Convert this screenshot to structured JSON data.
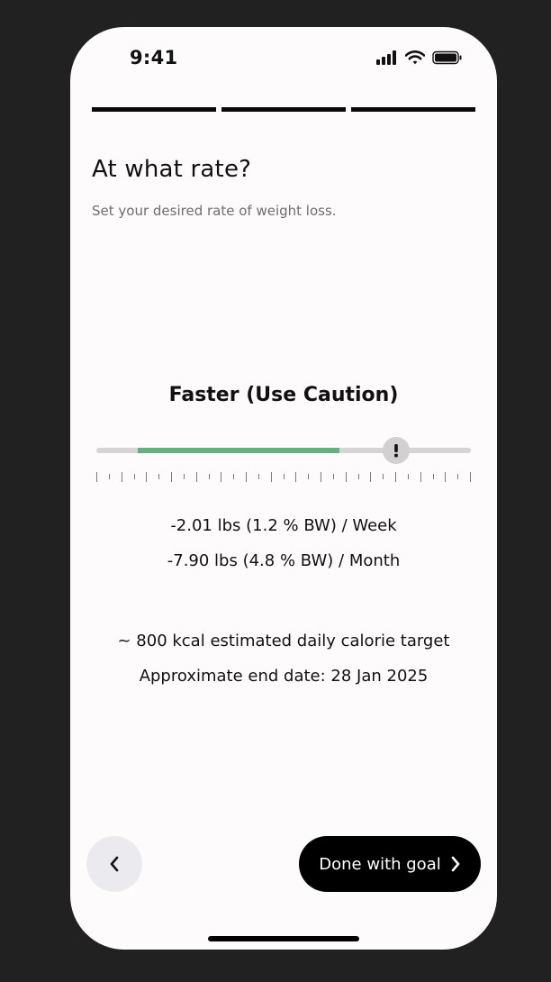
{
  "status_bar": {
    "time": "9:41",
    "icons": [
      "signal-icon",
      "wifi-icon",
      "battery-icon"
    ]
  },
  "progress": {
    "total_steps": 3,
    "completed_steps": 3
  },
  "header": {
    "title": "At what rate?",
    "subtitle": "Set your desired rate of weight loss."
  },
  "rate": {
    "label": "Faster (Use Caution)",
    "slider_level": 0.8,
    "recommended_range": [
      0.11,
      0.65
    ],
    "thumb_icon": "warning-exclamation-icon",
    "colors": {
      "track": "#d6d4d4",
      "recommended": "#66ad80",
      "thumb": "#d2d0d0"
    }
  },
  "stats": {
    "weekly": "-2.01 lbs (1.2 % BW) / Week",
    "monthly": "-7.90 lbs (4.8 % BW) / Month",
    "calories": "~ 800 kcal estimated daily calorie target",
    "end_date": "Approximate end date: 28 Jan 2025"
  },
  "footer": {
    "back_icon": "chevron-left-icon",
    "done_label": "Done with goal",
    "done_icon": "chevron-right-icon"
  }
}
